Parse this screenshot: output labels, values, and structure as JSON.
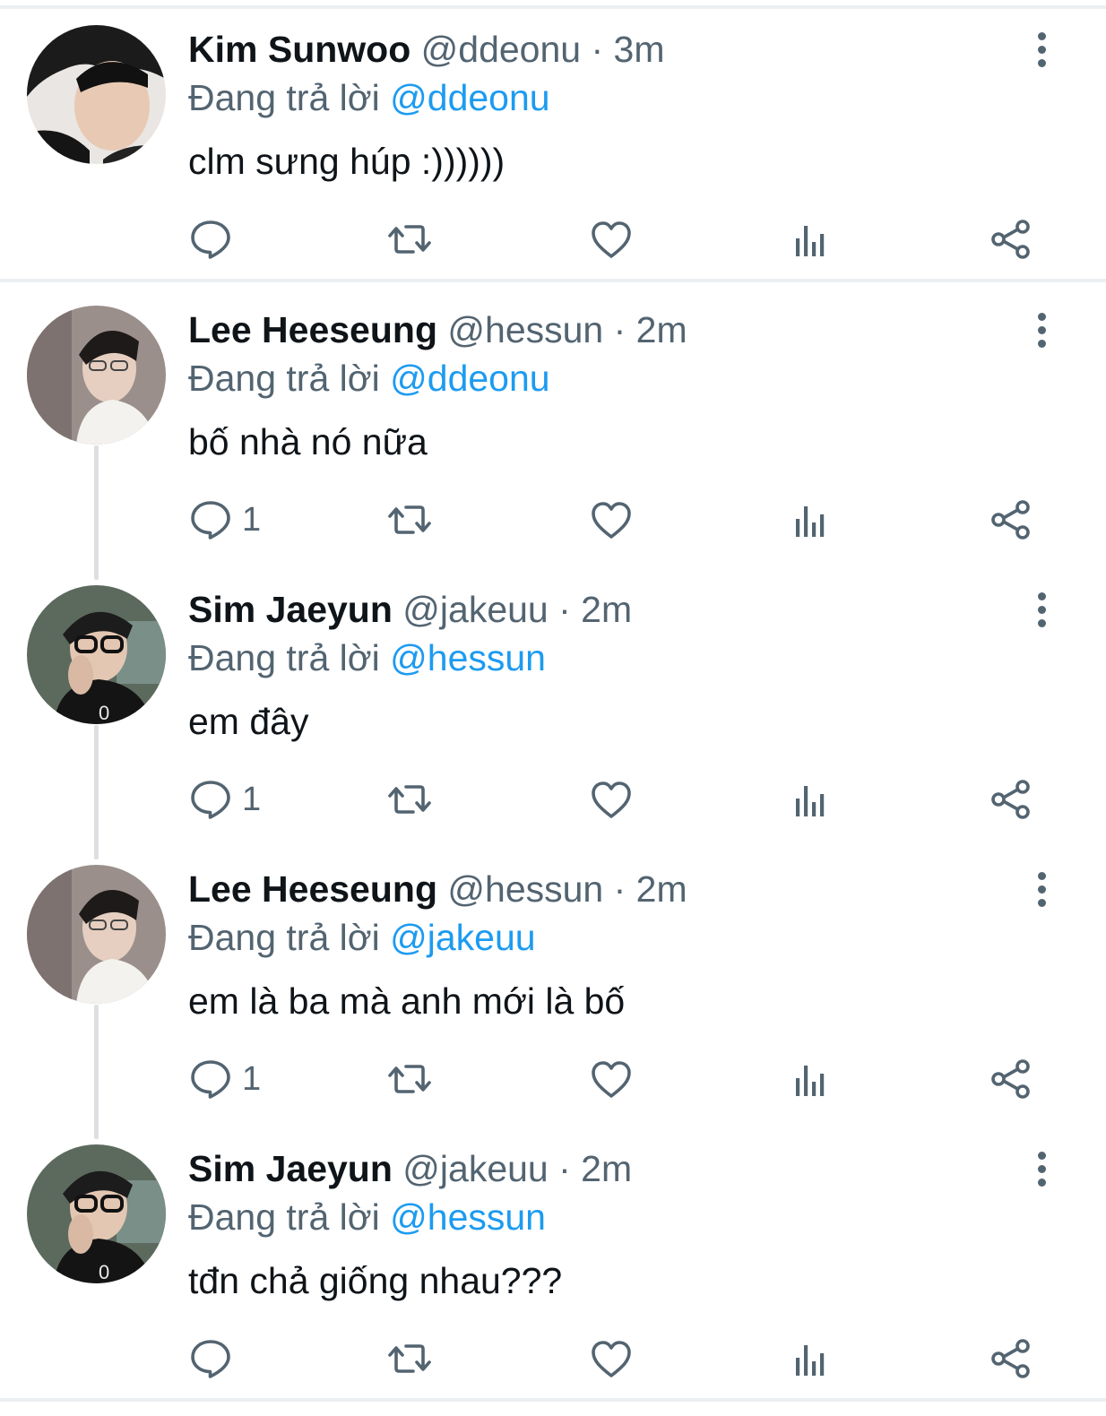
{
  "reply_prefix": "Đang trả lời",
  "tweets": [
    {
      "name": "Kim Sunwoo",
      "handle": "@ddeonu",
      "dot": "·",
      "time": "3m",
      "reply_to": "@ddeonu",
      "text": "clm sưng húp :))))))",
      "reply_count": "",
      "avatar": "avatar-kim-sunwoo"
    },
    {
      "name": "Lee Heeseung",
      "handle": "@hessun",
      "dot": "·",
      "time": "2m",
      "reply_to": "@ddeonu",
      "text": "bố nhà nó nữa",
      "reply_count": "1",
      "avatar": "avatar-lee-heeseung"
    },
    {
      "name": "Sim Jaeyun",
      "handle": "@jakeuu",
      "dot": "·",
      "time": "2m",
      "reply_to": "@hessun",
      "text": "em đây",
      "reply_count": "1",
      "avatar": "avatar-sim-jaeyun"
    },
    {
      "name": "Lee Heeseung",
      "handle": "@hessun",
      "dot": "·",
      "time": "2m",
      "reply_to": "@jakeuu",
      "text": "em là ba mà anh mới là bố",
      "reply_count": "1",
      "avatar": "avatar-lee-heeseung"
    },
    {
      "name": "Sim Jaeyun",
      "handle": "@jakeuu",
      "dot": "·",
      "time": "2m",
      "reply_to": "@hessun",
      "text": "tđn chả giống nhau???",
      "reply_count": "",
      "avatar": "avatar-sim-jaeyun"
    }
  ],
  "icons": {
    "reply": "reply-icon",
    "retweet": "retweet-icon",
    "like": "heart-icon",
    "views": "analytics-icon",
    "share": "share-icon",
    "more": "more-vertical-icon"
  },
  "colors": {
    "primary_text": "#0f1419",
    "secondary_text": "#536471",
    "mention": "#1d9bf0",
    "separator": "#eceff1",
    "thread_line": "#dcdfe2"
  }
}
